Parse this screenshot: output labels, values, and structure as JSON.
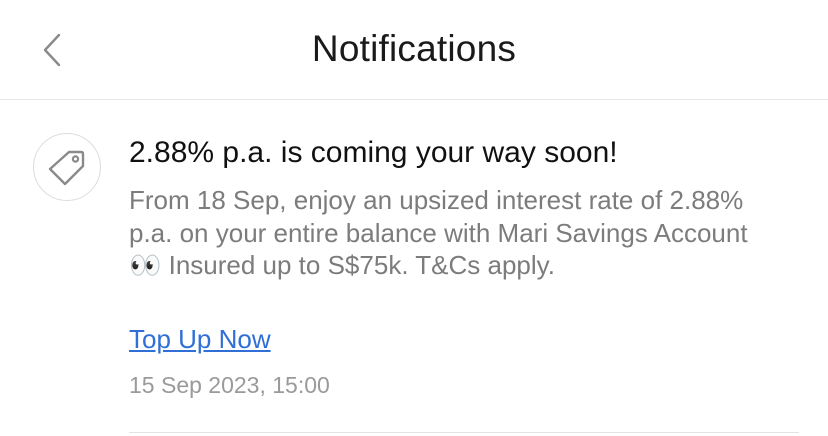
{
  "header": {
    "title": "Notifications",
    "back_icon": "chevron-left-icon"
  },
  "notification": {
    "icon": "tag-icon",
    "title": "2.88% p.a. is coming your way soon!",
    "body": "From 18 Sep, enjoy an upsized interest rate of 2.88% p.a. on your entire balance with Mari Savings Account 👀 Insured up to S$75k. T&Cs apply.",
    "cta_label": "Top Up Now",
    "timestamp": "15 Sep 2023, 15:00"
  },
  "colors": {
    "link": "#2f6fd6",
    "body_text": "#7c7c7c",
    "title_text": "#111111"
  }
}
